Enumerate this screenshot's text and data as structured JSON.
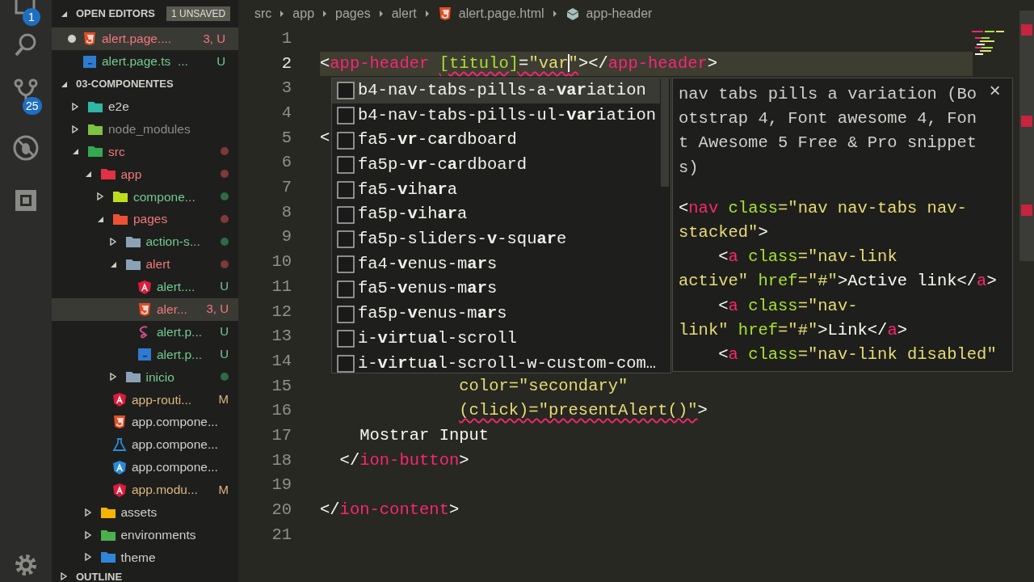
{
  "activity_bar": {
    "items": [
      {
        "kind": "explorer",
        "badge": "1"
      },
      {
        "kind": "search"
      },
      {
        "kind": "scm",
        "badge": "25"
      },
      {
        "kind": "debug"
      },
      {
        "kind": "extensions"
      }
    ],
    "settings": {
      "kind": "gear"
    }
  },
  "sidebar": {
    "open_editors": {
      "title": "OPEN EDITORS",
      "badge": "1 UNSAVED",
      "expanded": true,
      "files": [
        {
          "kind": "html",
          "name": "alert.page....",
          "color": "#f2777a",
          "status": "3, U",
          "dirty": true,
          "selected": true
        },
        {
          "kind": "ts",
          "name": "alert.page.ts  ...",
          "color": "#73c991",
          "status": "U",
          "dirty": false,
          "selected": false
        }
      ]
    },
    "explorer": {
      "title": "03-COMPONENTES",
      "expanded": true,
      "items": [
        {
          "kind": "e2e-folder",
          "name": "e2e",
          "color": "#cfcfca",
          "expanded": false,
          "selected": false
        },
        {
          "kind": "node-folder",
          "name": "node_modules",
          "color": "#8c8c88",
          "expanded": false,
          "selected": false
        },
        {
          "kind": "src-folder",
          "name": "src",
          "color": "#f2777a",
          "dot": {
            "color": "#7d3a3a"
          },
          "expanded": true,
          "selected": false,
          "children": [
            {
              "kind": "app-folder",
              "name": "app",
              "color": "#f2777a",
              "dot": {
                "color": "#7d3a3a"
              },
              "expanded": true,
              "selected": false,
              "children": [
                {
                  "kind": "components-folder",
                  "name": "compone...",
                  "color": "#73c991",
                  "dot": {
                    "color": "#2f6a46"
                  },
                  "expanded": false,
                  "selected": false
                },
                {
                  "kind": "pages-folder",
                  "name": "pages",
                  "color": "#f2777a",
                  "dot": {
                    "color": "#7d3a3a"
                  },
                  "expanded": true,
                  "selected": false,
                  "children": [
                    {
                      "kind": "folder",
                      "name": "action-s...",
                      "color": "#73c991",
                      "dot": {
                        "color": "#2f6a46"
                      },
                      "expanded": false,
                      "selected": false
                    },
                    {
                      "kind": "folder",
                      "name": "alert",
                      "color": "#f2777a",
                      "dot": {
                        "color": "#7d3a3a"
                      },
                      "expanded": true,
                      "selected": false,
                      "children": [
                        {
                          "kind": "angular",
                          "name": "alert....",
                          "color": "#73c991",
                          "status": "U",
                          "selected": false
                        },
                        {
                          "kind": "html",
                          "name": "aler...",
                          "color": "#f2777a",
                          "status": "3, U",
                          "selected": true
                        },
                        {
                          "kind": "sass",
                          "name": "alert.p...",
                          "color": "#73c991",
                          "status": "U",
                          "selected": false
                        },
                        {
                          "kind": "ts",
                          "name": "alert.p...",
                          "color": "#73c991",
                          "status": "U",
                          "selected": false
                        }
                      ]
                    },
                    {
                      "kind": "folder",
                      "name": "inicio",
                      "color": "#73c991",
                      "dot": {
                        "color": "#2f6a46"
                      },
                      "expanded": false,
                      "selected": false
                    }
                  ]
                },
                {
                  "kind": "angular",
                  "name": "app-routi...",
                  "color": "#dcb77e",
                  "status": "M",
                  "selected": false
                },
                {
                  "kind": "html",
                  "name": "app.compone...",
                  "color": "#cfcfca",
                  "selected": false
                },
                {
                  "kind": "test",
                  "name": "app.compone...",
                  "color": "#cfcfca",
                  "selected": false
                },
                {
                  "kind": "angular-blue",
                  "name": "app.compone...",
                  "color": "#cfcfca",
                  "selected": false
                },
                {
                  "kind": "angular",
                  "name": "app.modu...",
                  "color": "#dcb77e",
                  "status": "M",
                  "selected": false
                }
              ]
            },
            {
              "kind": "assets-folder",
              "name": "assets",
              "color": "#cfcfca",
              "expanded": false,
              "selected": false
            },
            {
              "kind": "environments-folder",
              "name": "environments",
              "color": "#cfcfca",
              "expanded": false,
              "selected": false
            },
            {
              "kind": "theme-folder",
              "name": "theme",
              "color": "#cfcfca",
              "expanded": false,
              "selected": false
            }
          ]
        }
      ]
    },
    "outline": {
      "title": "OUTLINE",
      "expanded": false
    }
  },
  "breadcrumbs": [
    {
      "text": "src"
    },
    {
      "text": "app"
    },
    {
      "text": "pages"
    },
    {
      "text": "alert"
    },
    {
      "text": "alert.page.html",
      "kind": "html"
    },
    {
      "text": "app-header",
      "kind": "symbol"
    }
  ],
  "editor": {
    "lines": [
      {
        "number": "1",
        "current": false
      },
      {
        "number": "2",
        "current": true,
        "tokens": [
          {
            "text": "<",
            "kind": "punct"
          },
          {
            "text": "app-header ",
            "kind": "tag"
          },
          {
            "text": "[titulo]",
            "kind": "attr",
            "squiggle": true
          },
          {
            "text": "=",
            "kind": "punct",
            "squiggle": true
          },
          {
            "text": "\"var",
            "kind": "string",
            "squiggle": true,
            "cursor": true
          },
          {
            "text": "\"",
            "kind": "string",
            "squiggle": true
          },
          {
            "text": "></",
            "kind": "punct"
          },
          {
            "text": "app-header",
            "kind": "tag"
          },
          {
            "text": ">",
            "kind": "punct"
          }
        ]
      },
      {
        "number": "3",
        "current": false
      },
      {
        "number": "4",
        "current": false
      },
      {
        "number": "5",
        "current": false,
        "tokens": [
          {
            "text": "<",
            "kind": "punct"
          }
        ]
      },
      {
        "number": "6",
        "current": false
      },
      {
        "number": "7",
        "current": false
      },
      {
        "number": "8",
        "current": false
      },
      {
        "number": "9",
        "current": false
      },
      {
        "number": "10",
        "current": false
      },
      {
        "number": "11",
        "current": false
      },
      {
        "number": "12",
        "current": false
      },
      {
        "number": "13",
        "current": false
      },
      {
        "number": "14",
        "current": false
      },
      {
        "number": "15",
        "current": false,
        "tokens": [
          {
            "text": "              color=\"secondary\"",
            "kind": "string"
          }
        ]
      },
      {
        "number": "16",
        "current": false,
        "tokens": [
          {
            "text": "              (click)=\"presentAlert()\"",
            "kind": "string",
            "squiggle": true
          },
          {
            "text": ">",
            "kind": "punct"
          }
        ]
      },
      {
        "number": "17",
        "current": false,
        "tokens": [
          {
            "text": "    Mostrar Input",
            "kind": "punct"
          }
        ]
      },
      {
        "number": "18",
        "current": false,
        "tokens": [
          {
            "text": "  </",
            "kind": "punct"
          },
          {
            "text": "ion-button",
            "kind": "tag"
          },
          {
            "text": ">",
            "kind": "punct"
          }
        ]
      },
      {
        "number": "19",
        "current": false
      },
      {
        "number": "20",
        "current": false,
        "tokens": [
          {
            "text": "</",
            "kind": "punct"
          },
          {
            "text": "ion-content",
            "kind": "tag"
          },
          {
            "text": ">",
            "kind": "punct"
          }
        ]
      },
      {
        "number": "21",
        "current": false
      }
    ]
  },
  "suggest": {
    "items": [
      {
        "label": "b4-nav-tabs-pills-a-**var**iation",
        "selected": true
      },
      {
        "label": "b4-nav-tabs-pills-ul-**var**iation",
        "selected": false
      },
      {
        "label": "fa5-**vr**-c**a**rdboard",
        "selected": false
      },
      {
        "label": "fa5p-**vr**-c**a**rdboard",
        "selected": false
      },
      {
        "label": "fa5-**v**ih**ar**a",
        "selected": false
      },
      {
        "label": "fa5p-**v**ih**ar**a",
        "selected": false
      },
      {
        "label": "fa5p-sliders-**v**-squ**ar**e",
        "selected": false
      },
      {
        "label": "fa4-**v**enus-m**ar**s",
        "selected": false
      },
      {
        "label": "fa5-**v**enus-m**ar**s",
        "selected": false
      },
      {
        "label": "fa5p-**v**enus-m**ar**s",
        "selected": false
      },
      {
        "label": "i-**v**i**r**tu**a**l-scroll",
        "selected": false
      },
      {
        "label": "i-**v**i**r**tu**a**l-scroll-w-custom-com…",
        "selected": false
      }
    ],
    "details": {
      "description": "nav tabs pills a variation (Bootstrap 4, Font awesome 4, Font Awesome 5 Free & Pro snippets)",
      "close": "×",
      "code": [
        [
          {
            "text": "<",
            "kind": "punct"
          },
          {
            "text": "nav",
            "kind": "tag"
          },
          {
            "text": " class",
            "kind": "attr"
          },
          {
            "text": "=\"nav nav-tabs nav-stacked\"",
            "kind": "string"
          },
          {
            "text": ">",
            "kind": "punct"
          }
        ],
        [
          {
            "text": "    <",
            "kind": "punct"
          },
          {
            "text": "a",
            "kind": "tag"
          },
          {
            "text": " class",
            "kind": "attr"
          },
          {
            "text": "=\"nav-link active\"",
            "kind": "string"
          },
          {
            "text": " href",
            "kind": "attr"
          },
          {
            "text": "=\"#\"",
            "kind": "string"
          },
          {
            "text": ">Active link</",
            "kind": "punct"
          },
          {
            "text": "a",
            "kind": "tag"
          },
          {
            "text": ">",
            "kind": "punct"
          }
        ],
        [
          {
            "text": "    <",
            "kind": "punct"
          },
          {
            "text": "a",
            "kind": "tag"
          },
          {
            "text": " class",
            "kind": "attr"
          },
          {
            "text": "=\"nav-link\"",
            "kind": "string"
          },
          {
            "text": " href",
            "kind": "attr"
          },
          {
            "text": "=\"#\"",
            "kind": "string"
          },
          {
            "text": ">Link</",
            "kind": "punct"
          },
          {
            "text": "a",
            "kind": "tag"
          },
          {
            "text": ">",
            "kind": "punct"
          }
        ],
        [
          {
            "text": "    <",
            "kind": "punct"
          },
          {
            "text": "a",
            "kind": "tag"
          },
          {
            "text": " class",
            "kind": "attr"
          },
          {
            "text": "=\"nav-link disabled\"",
            "kind": "string"
          }
        ]
      ]
    }
  }
}
